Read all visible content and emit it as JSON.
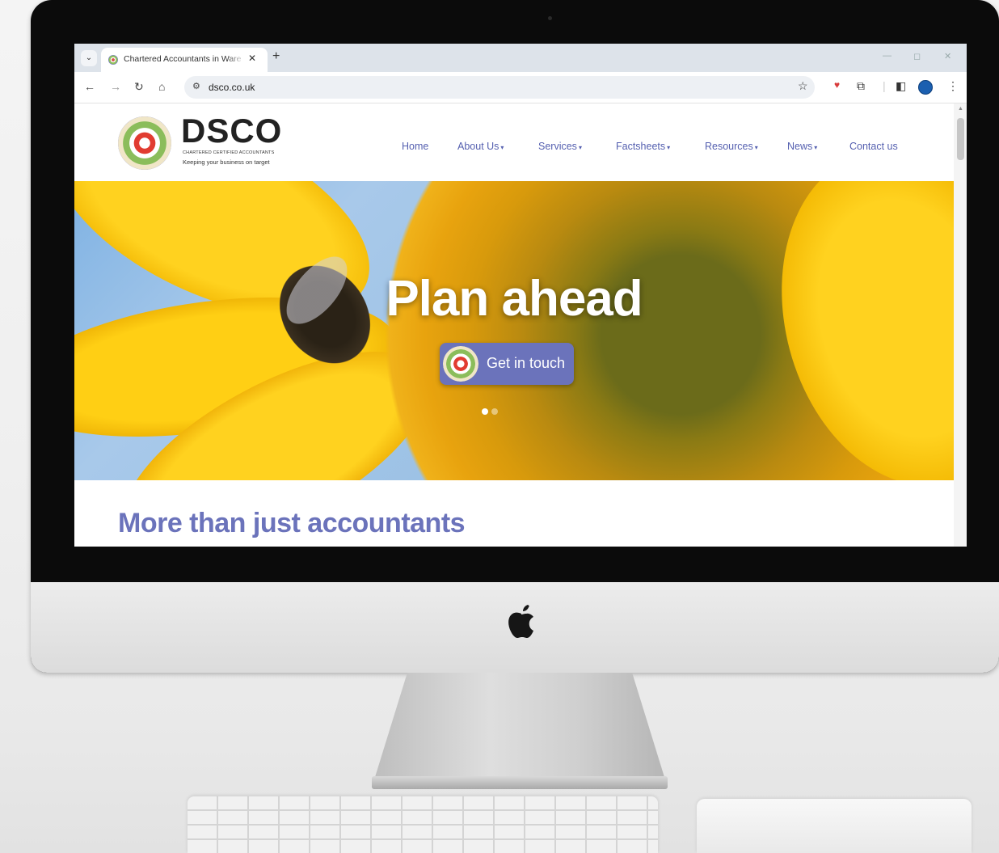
{
  "browser": {
    "tab_title": "Chartered Accountants in Ware",
    "tab_list_icon": "chevron-down-icon",
    "tab_close": "✕",
    "new_tab": "+",
    "url": "dsco.co.uk",
    "nav_icons": [
      "back-arrow-icon",
      "forward-arrow-icon",
      "reload-icon",
      "home-icon"
    ],
    "toolbar_icons": [
      "bookmark-star-icon",
      "extension-pocket-icon",
      "extensions-puzzle-icon",
      "side-panel-icon",
      "profile-avatar-icon",
      "menu-kebab-icon"
    ]
  },
  "site": {
    "logo": {
      "name": "DSCO",
      "tagline_small": "CHARTERED CERTIFIED ACCOUNTANTS",
      "tagline": "Keeping your business on target"
    },
    "nav": [
      {
        "label": "Home",
        "dropdown": false
      },
      {
        "label": "About Us",
        "dropdown": true
      },
      {
        "label": "Services",
        "dropdown": true
      },
      {
        "label": "Factsheets",
        "dropdown": true
      },
      {
        "label": "Resources",
        "dropdown": true
      },
      {
        "label": "News",
        "dropdown": true
      },
      {
        "label": "Contact us",
        "dropdown": false
      }
    ],
    "hero": {
      "title": "Plan ahead",
      "cta_label": "Get in touch",
      "slide_count": 2,
      "active_slide": 1
    },
    "section_title": "More than just accountants"
  },
  "colors": {
    "brand_purple": "#6b73bb",
    "nav_link": "#5560b0",
    "logo_red": "#e13c31",
    "logo_green": "#8bbd5b"
  }
}
